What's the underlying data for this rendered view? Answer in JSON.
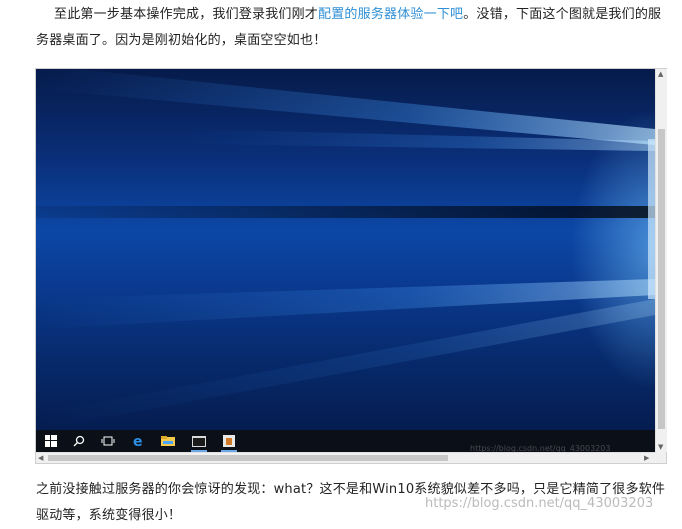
{
  "article": {
    "para1_before": "至此第一步基本操作完成，我们登录我们刚才",
    "para1_link": "配置的服务器体验一下吧",
    "para1_after": "。没错，下面这个图就是我们的服务器桌面了。因为是刚初始化的，桌面空空如也！",
    "para2": "之前没接触过服务器的你会惊讶的发现：what？这不是和Win10系统貌似差不多吗，只是它精简了很多软件驱动等，系统变得很小！"
  },
  "taskbar": {
    "icons": [
      "windows-start-icon",
      "search-icon",
      "task-view-icon",
      "edge-icon",
      "file-explorer-icon",
      "terminal-icon",
      "installer-icon"
    ]
  },
  "watermark": "https://blog.csdn.net/qq_43003203",
  "colors": {
    "link": "#2e8fd6",
    "desktop": "#0c47a6",
    "taskbar": "#0b0f17"
  }
}
